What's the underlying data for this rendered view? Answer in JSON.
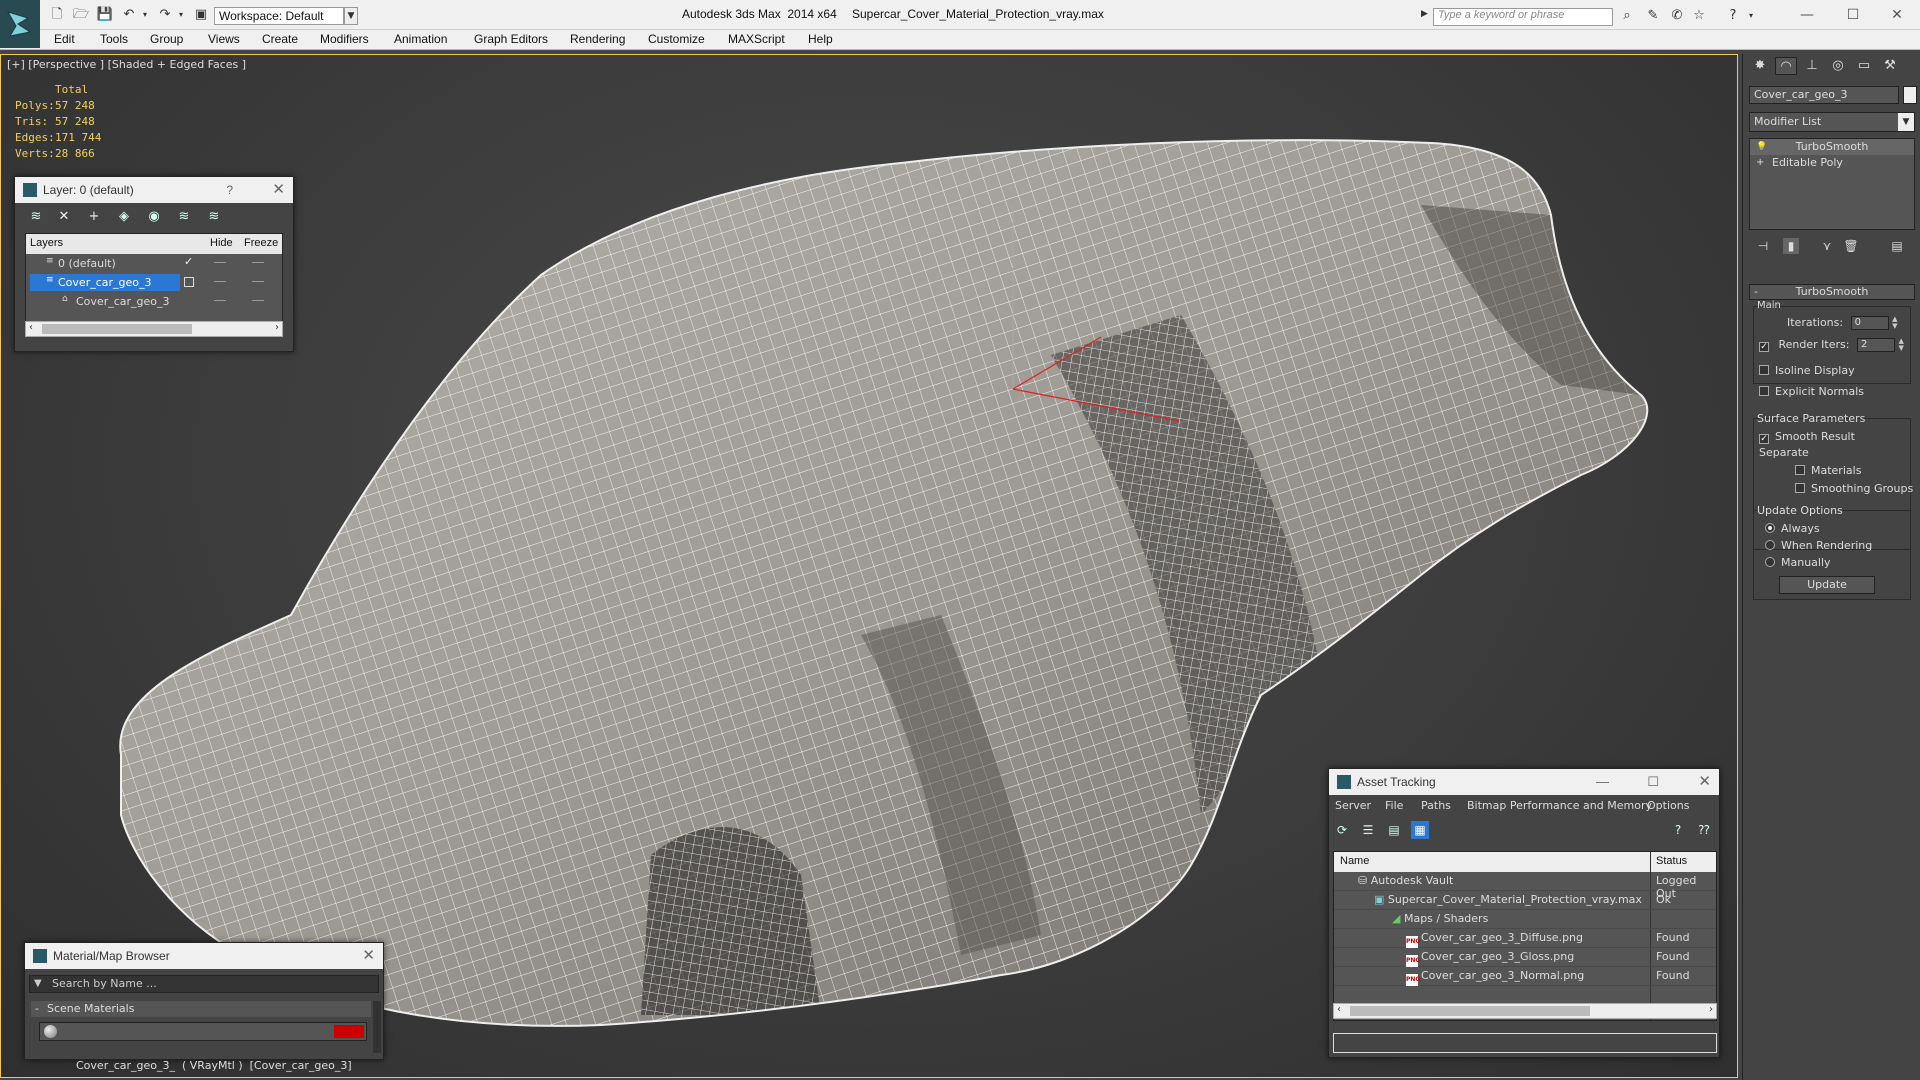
{
  "titlebar": {
    "workspace": "Workspace: Default",
    "app_title": "Autodesk 3ds Max  2014 x64",
    "file_title": "Supercar_Cover_Material_Protection_vray.max",
    "search_placeholder": "Type a keyword or phrase"
  },
  "menu": [
    "Edit",
    "Tools",
    "Group",
    "Views",
    "Create",
    "Modifiers",
    "Animation",
    "Graph Editors",
    "Rendering",
    "Customize",
    "MAXScript",
    "Help"
  ],
  "viewport": {
    "label": "[+] [Perspective ] [Shaded + Edged Faces ]",
    "stats": {
      "total": "Total",
      "rows": [
        {
          "label": "Polys:",
          "value": "57 248"
        },
        {
          "label": "Tris:",
          "value": "57 248"
        },
        {
          "label": "Edges:",
          "value": "171 744"
        },
        {
          "label": "Verts:",
          "value": "28 866"
        }
      ]
    }
  },
  "layer_dialog": {
    "title": "Layer: 0 (default)",
    "help": "?",
    "columns": {
      "layers": "Layers",
      "hide": "Hide",
      "freeze": "Freeze"
    },
    "rows": [
      {
        "name": "0 (default)",
        "selected": false
      },
      {
        "name": "Cover_car_geo_3",
        "selected": true
      },
      {
        "name": "Cover_car_geo_3",
        "selected": false
      }
    ]
  },
  "command_panel": {
    "object_name": "Cover_car_geo_3",
    "modifier_list": "Modifier List",
    "stack": [
      "TurboSmooth",
      "Editable Poly"
    ],
    "rollout_title": "TurboSmooth",
    "main_label": "Main",
    "iterations_label": "Iterations:",
    "iterations_value": "0",
    "render_iters_label": "Render Iters:",
    "render_iters_value": "2",
    "isoline": "Isoline Display",
    "explicit_normals": "Explicit Normals",
    "surface_params": "Surface Parameters",
    "smooth_result": "Smooth Result",
    "separate": "Separate",
    "materials": "Materials",
    "smoothing_groups": "Smoothing Groups",
    "update_options": "Update Options",
    "always": "Always",
    "when_rendering": "When Rendering",
    "manually": "Manually",
    "update_button": "Update"
  },
  "material_browser": {
    "title": "Material/Map Browser",
    "search_placeholder": "Search by Name ...",
    "section": "Scene Materials",
    "item": "Cover_car_geo_3_  ( VRayMtl )  [Cover_car_geo_3]",
    "swatch_color": "#cc0000"
  },
  "asset_tracking": {
    "title": "Asset Tracking",
    "menu": [
      "Server",
      "File",
      "Paths",
      "Bitmap Performance and Memory",
      "Options"
    ],
    "columns": {
      "name": "Name",
      "status": "Status"
    },
    "rows": [
      {
        "name": "Autodesk Vault",
        "status": "Logged Out",
        "indent": 1,
        "icon": "vault"
      },
      {
        "name": "Supercar_Cover_Material_Protection_vray.max",
        "status": "Ok",
        "indent": 2,
        "icon": "max"
      },
      {
        "name": "Maps / Shaders",
        "status": "",
        "indent": 3,
        "icon": "maps"
      },
      {
        "name": "Cover_car_geo_3_Diffuse.png",
        "status": "Found",
        "indent": 4,
        "icon": "png"
      },
      {
        "name": "Cover_car_geo_3_Gloss.png",
        "status": "Found",
        "indent": 4,
        "icon": "png"
      },
      {
        "name": "Cover_car_geo_3_Normal.png",
        "status": "Found",
        "indent": 4,
        "icon": "png"
      }
    ]
  }
}
